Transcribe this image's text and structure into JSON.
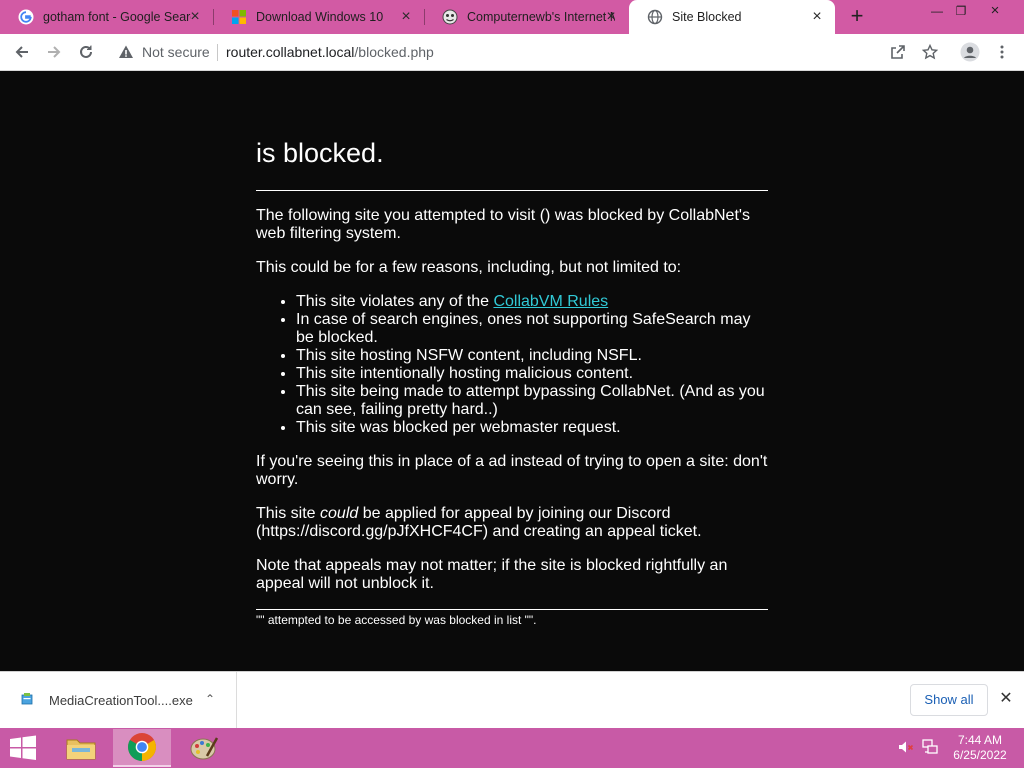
{
  "browser": {
    "tabs": [
      {
        "title": "gotham font - Google Search",
        "icon": "google-icon",
        "active": false
      },
      {
        "title": "Download Windows 10",
        "icon": "windows-logo-icon",
        "active": false
      },
      {
        "title": "Computernewb's Internet Machine",
        "icon": "computernewb-icon",
        "active": false
      },
      {
        "title": "Site Blocked",
        "icon": "globe-icon",
        "active": true
      }
    ],
    "security_label": "Not secure",
    "url_host": "router.collabnet.local",
    "url_path": "/blocked.php"
  },
  "page": {
    "heading": "is blocked.",
    "intro": "The following site you attempted to visit () was blocked by CollabNet's web filtering system.",
    "reasons_intro": "This could be for a few reasons, including, but not limited to:",
    "reason_1_prefix": "This site violates any of the ",
    "reason_1_link": "CollabVM Rules",
    "reasons": [
      "In case of search engines, ones not supporting SafeSearch may be blocked.",
      "This site hosting NSFW content, including NSFL.",
      "This site intentionally hosting malicious content.",
      "This site being made to attempt bypassing CollabNet. (And as you can see, failing pretty hard..)",
      "This site was blocked per webmaster request."
    ],
    "ad_note": "If you're seeing this in place of a ad instead of trying to open a site: don't worry.",
    "appeal_prefix": "This site ",
    "appeal_em": "could",
    "appeal_suffix": " be applied for appeal by joining our Discord (https://discord.gg/pJfXHCF4CF) and creating an appeal ticket.",
    "note": "Note that appeals may not matter; if the site is blocked rightfully an appeal will not unblock it.",
    "footer": "\"\" attempted to be accessed by was blocked in list \"\"."
  },
  "downloads": {
    "file_name": "MediaCreationTool....exe",
    "show_all_label": "Show all"
  },
  "taskbar": {
    "time": "7:44 AM",
    "date": "6/25/2022"
  },
  "colors": {
    "frame": "#d25aa4",
    "taskbar": "#c85aa6",
    "link": "#31c9d6",
    "page_bg": "#0a0a0a"
  }
}
